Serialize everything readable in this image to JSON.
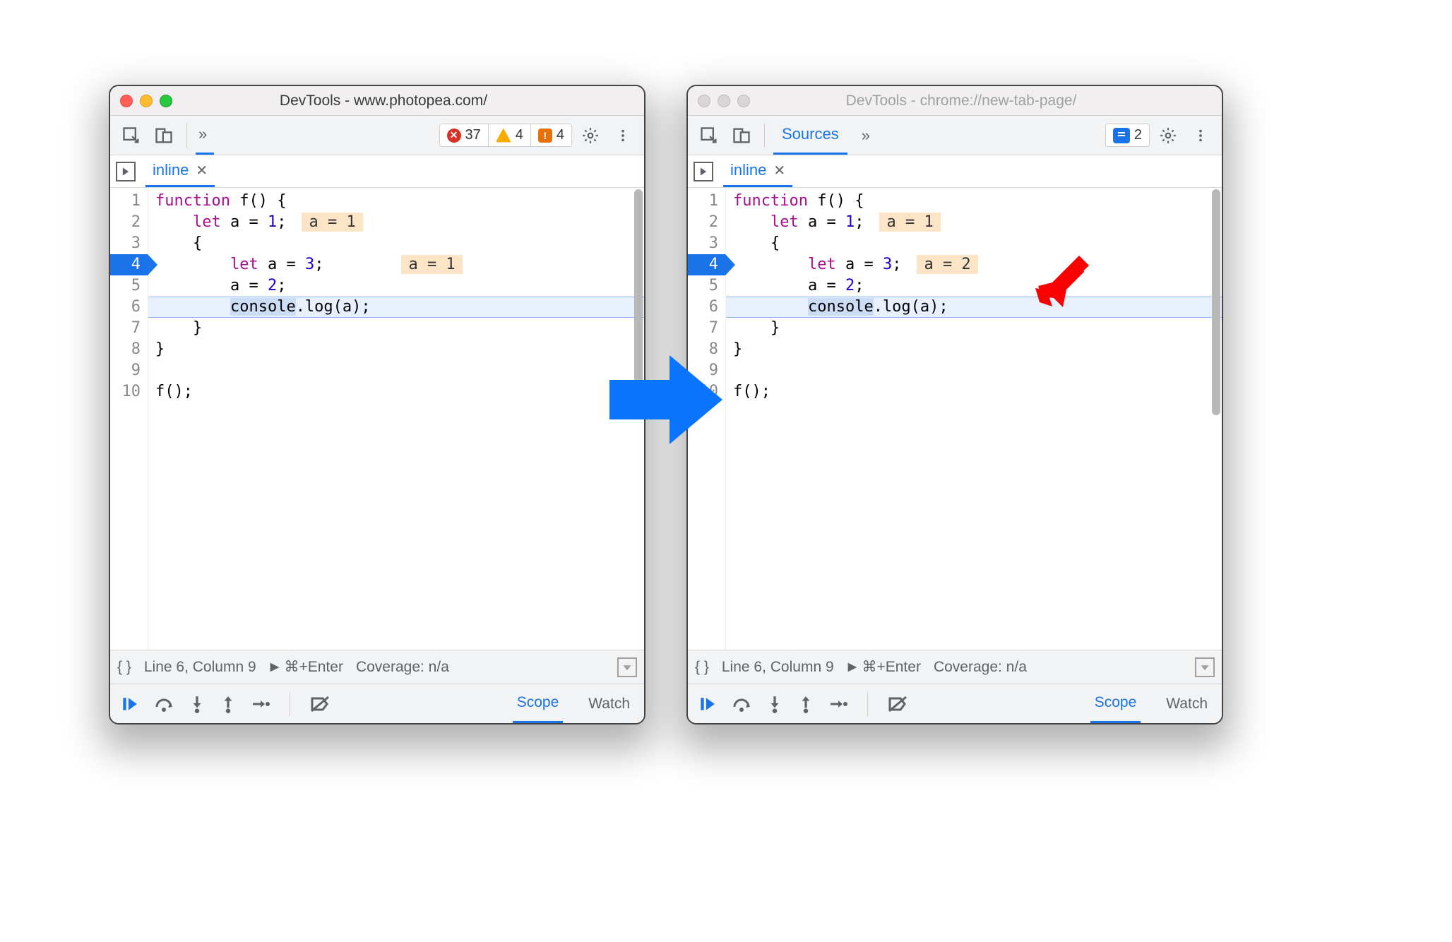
{
  "left": {
    "title": "DevTools - www.photopea.com/",
    "active_window": true,
    "toolbar": {
      "more": "»",
      "errors": "37",
      "warn_yellow": "4",
      "warn_orange": "4"
    },
    "file_tab": "inline",
    "code": {
      "lines": [
        "1",
        "2",
        "3",
        "4",
        "5",
        "6",
        "7",
        "8",
        "9",
        "10"
      ],
      "exec_line_index": 3,
      "hover_line_index": 5,
      "l1_kw": "function",
      "l1_rest": " f() {",
      "l2_kw": "let",
      "l2_rest": " a = ",
      "l2_num": "1",
      "l2_semi": ";",
      "l2_inline": "a = 1",
      "l3": "{",
      "l4_kw": "let",
      "l4_rest": " a = ",
      "l4_num": "3",
      "l4_semi": ";",
      "l4_inline": "a = 1",
      "l5_a": "a = ",
      "l5_num": "2",
      "l5_semi": ";",
      "l6_sel": "console",
      "l6_rest": ".log(a);",
      "l7": "}",
      "l8": "}",
      "l9": "",
      "l10": "f();"
    },
    "status": {
      "pretty": "{ }",
      "pos": "Line 6, Column 9",
      "run": "⌘+Enter",
      "coverage": "Coverage: n/a"
    },
    "debugger": {
      "scope": "Scope",
      "watch": "Watch"
    }
  },
  "right": {
    "title": "DevTools - chrome://new-tab-page/",
    "active_window": false,
    "toolbar": {
      "sources": "Sources",
      "more": "»",
      "issues": "2"
    },
    "file_tab": "inline",
    "code": {
      "lines": [
        "1",
        "2",
        "3",
        "4",
        "5",
        "6",
        "7",
        "8",
        "9",
        "10"
      ],
      "exec_line_index": 3,
      "hover_line_index": 5,
      "l1_kw": "function",
      "l1_rest": " f() {",
      "l2_kw": "let",
      "l2_rest": " a = ",
      "l2_num": "1",
      "l2_semi": ";",
      "l2_inline": "a = 1",
      "l3": "{",
      "l4_kw": "let",
      "l4_rest": " a = ",
      "l4_num": "3",
      "l4_semi": ";",
      "l4_inline": "a = 2",
      "l5_a": "a = ",
      "l5_num": "2",
      "l5_semi": ";",
      "l6_sel": "console",
      "l6_rest": ".log(a);",
      "l7": "}",
      "l8": "}",
      "l9": "",
      "l10": "f();"
    },
    "status": {
      "pretty": "{ }",
      "pos": "Line 6, Column 9",
      "run": "⌘+Enter",
      "coverage": "Coverage: n/a"
    },
    "debugger": {
      "scope": "Scope",
      "watch": "Watch"
    }
  }
}
